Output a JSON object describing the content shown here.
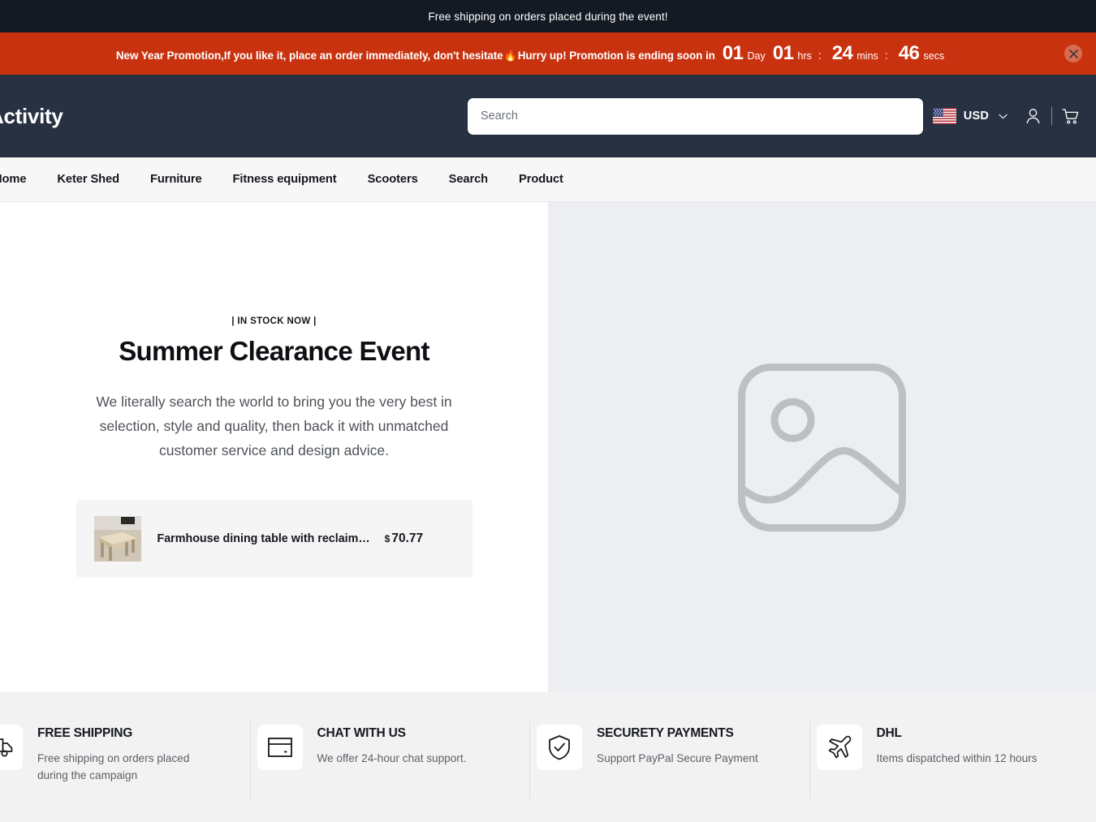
{
  "announcement": {
    "text": "Free shipping on orders placed during the event!"
  },
  "promo": {
    "message": "New Year Promotion,If you like it, place an order immediately, don't hesitate",
    "flame_icon": "fire-emoji",
    "urgency": "Hurry up! Promotion is ending soon in",
    "countdown": {
      "days_value": "01",
      "days_label": "Day",
      "hours_value": "01",
      "hours_label": "hrs",
      "minutes_value": "24",
      "minutes_label": "mins",
      "seconds_value": "46",
      "seconds_label": "secs",
      "separator": ":"
    },
    "close_icon": "close-icon",
    "bg_color": "#c9320f"
  },
  "header": {
    "logo": "Activity",
    "search": {
      "placeholder": "Search",
      "value": ""
    },
    "currency": {
      "flag_icon": "us-flag-icon",
      "code": "USD",
      "chevron_icon": "chevron-down-icon"
    },
    "account_icon": "user-icon",
    "cart_icon": "cart-icon",
    "bg_color": "#273142"
  },
  "nav": {
    "items": [
      {
        "label": "Home"
      },
      {
        "label": "Keter Shed"
      },
      {
        "label": "Furniture"
      },
      {
        "label": "Fitness equipment"
      },
      {
        "label": "Scooters"
      },
      {
        "label": "Search"
      },
      {
        "label": "Product"
      }
    ]
  },
  "hero": {
    "eyebrow": "| IN STOCK NOW |",
    "title": "Summer Clearance Event",
    "copy": "We literally search the world to bring you the very best in selection, style and quality, then back it with unmatched customer service and design advice.",
    "product": {
      "thumb_icon": "farmhouse-dining-table-thumbnail",
      "title": "Farmhouse dining table with reclaim…",
      "currency_symbol": "$",
      "price": "70.77"
    },
    "carousel": {
      "active_index": 0,
      "slide_count": 2
    },
    "media_icon": "image-placeholder-icon",
    "left_bg": "#ffffff",
    "right_bg": "#eceef1"
  },
  "features": [
    {
      "icon": "truck-icon",
      "title": "FREE SHIPPING",
      "desc": "Free shipping on orders placed during the campaign"
    },
    {
      "icon": "chat-window-icon",
      "title": "CHAT WITH US",
      "desc": "We offer 24-hour chat support."
    },
    {
      "icon": "shield-check-icon",
      "title": "SECURETY PAYMENTS",
      "desc": "Support PayPal Secure Payment"
    },
    {
      "icon": "airplane-icon",
      "title": "DHL",
      "desc": "Items dispatched within 12 hours"
    }
  ]
}
